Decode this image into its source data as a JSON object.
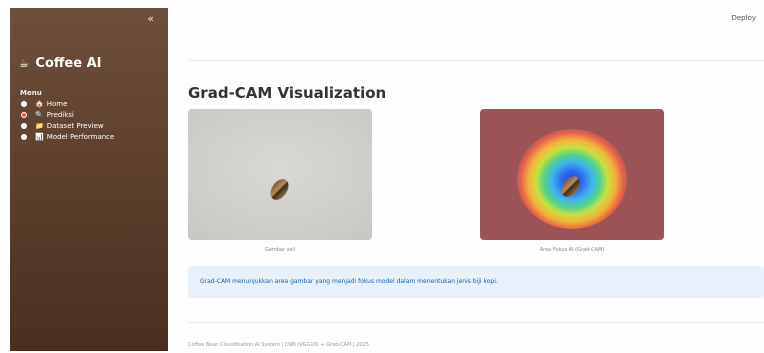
{
  "sidebar": {
    "collapse_glyph": "«",
    "brand_icon": "coffee-cup-icon",
    "brand": "Coffee AI",
    "menu_title": "Menu",
    "items": [
      {
        "icon": "🏠",
        "label": "Home",
        "selected": false
      },
      {
        "icon": "🔍",
        "label": "Prediksi",
        "selected": true
      },
      {
        "icon": "📁",
        "label": "Dataset Preview",
        "selected": false
      },
      {
        "icon": "📊",
        "label": "Model Performance",
        "selected": false
      }
    ]
  },
  "header": {
    "deploy_label": "Deploy"
  },
  "main": {
    "title": "Grad-CAM Visualization",
    "images": [
      {
        "caption": "Gambar asli"
      },
      {
        "caption": "Area Fokus AI (Grad-CAM)"
      }
    ],
    "info_text": "Grad-CAM menunjukkan area gambar yang menjadi fokus model dalam menentukan jenis biji kopi.",
    "footer": "Coffee Bean Classification AI System | CNN (VGG16) + Grad-CAM | 2025"
  },
  "colors": {
    "sidebar_top": "#6e4f3c",
    "sidebar_bottom": "#4a2f20",
    "selected_radio": "#ff4b4b",
    "info_bg": "#e8f1fb",
    "info_text": "#1a5fa8"
  }
}
